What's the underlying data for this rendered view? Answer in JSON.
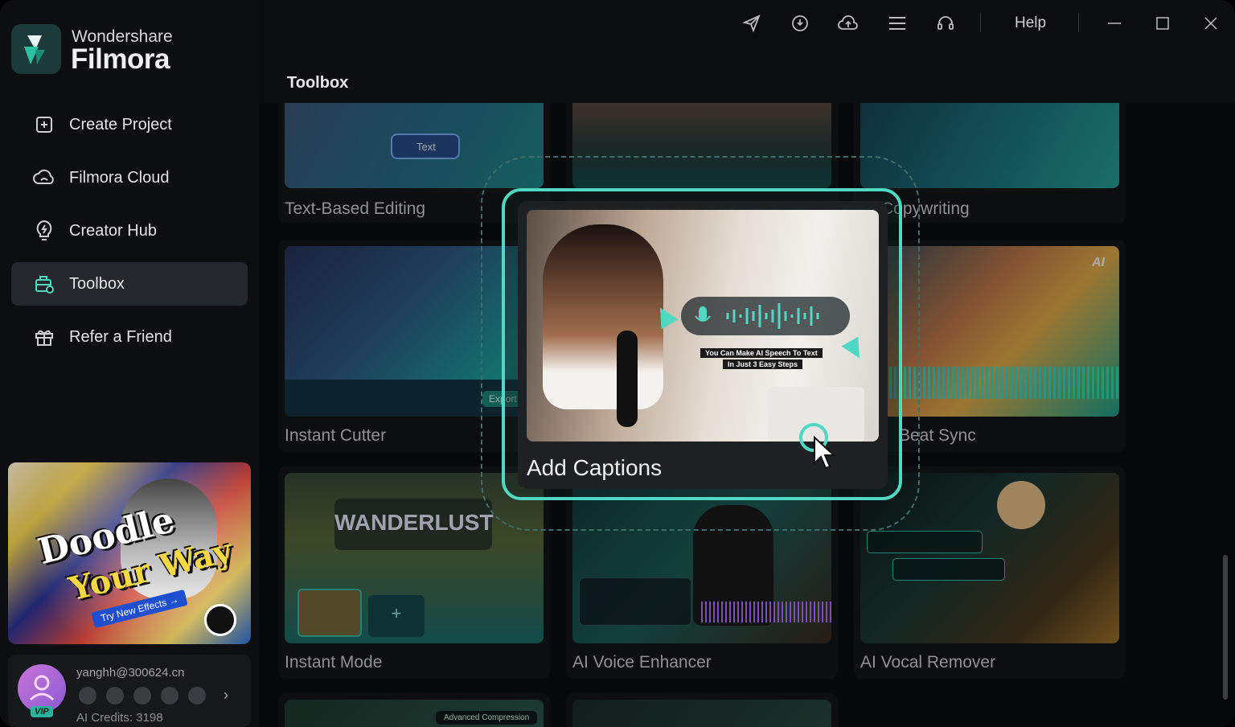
{
  "app": {
    "brand_small": "Wondershare",
    "brand_big": "Filmora",
    "accent": "#4fd8c2"
  },
  "topbar": {
    "icons": [
      "send-icon",
      "download-icon",
      "cloud-sync-icon",
      "menu-icon",
      "headset-icon"
    ],
    "help_label": "Help"
  },
  "sidebar": {
    "items": [
      {
        "label": "Create Project",
        "icon": "plus-square-icon"
      },
      {
        "label": "Filmora Cloud",
        "icon": "cloud-icon"
      },
      {
        "label": "Creator Hub",
        "icon": "bulb-icon"
      },
      {
        "label": "Toolbox",
        "icon": "toolbox-icon",
        "active": true
      },
      {
        "label": "Refer a Friend",
        "icon": "gift-icon"
      }
    ],
    "promo": {
      "line1": "Doodle",
      "line2": "Your Way",
      "cta": "Try New Effects →"
    },
    "user": {
      "email": "yanghh@300624.cn",
      "credits": "AI Credits: 3198",
      "badge": "VIP"
    }
  },
  "page": {
    "title": "Toolbox"
  },
  "tools": {
    "text_based": "Text-Based Editing",
    "copywriting": "Copywriting",
    "instant_cutter": "Instant Cutter",
    "beat_sync": "Beat Sync",
    "instant_mode": "Instant Mode",
    "voice_enhancer": "AI Voice Enhancer",
    "vocal_remover": "AI Vocal Remover"
  },
  "thumb_text": {
    "text_chip": "Text",
    "wanderlust": "WANDERLUST",
    "ai_badge": "AI",
    "speech_caption_1": "You Can Make AI Speech To Text",
    "speech_caption_2": "In Just 3 Easy Steps",
    "export_chip": "Export",
    "advanced_compression": "Advanced Compression"
  },
  "feature": {
    "label": "Add Captions"
  }
}
